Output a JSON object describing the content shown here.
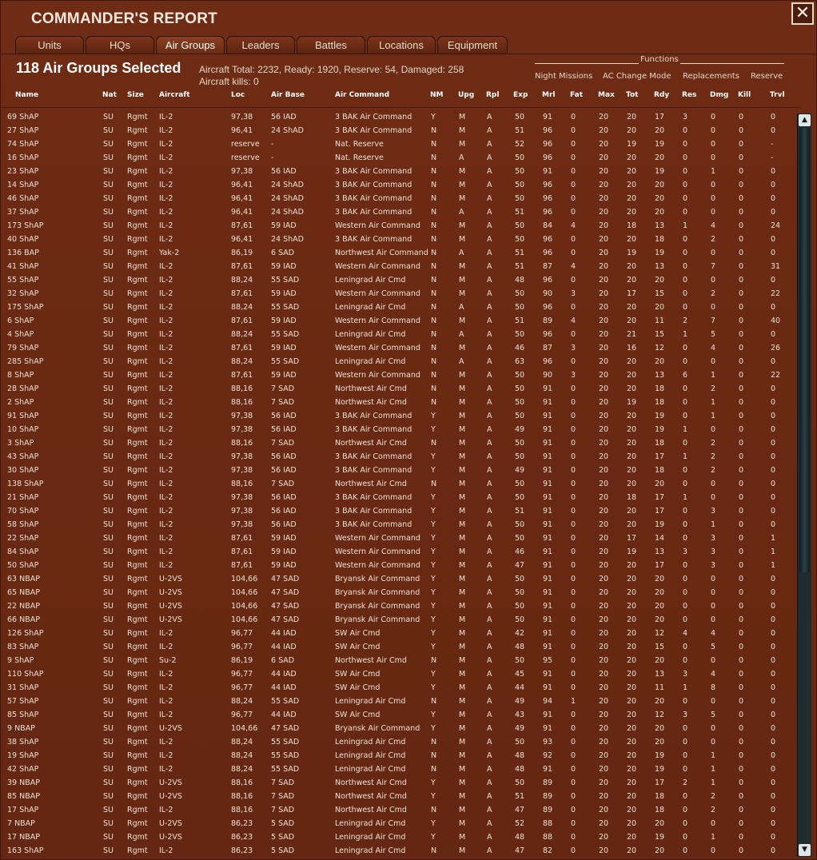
{
  "window": {
    "title": "COMMANDER'S REPORT",
    "close_label": "✕"
  },
  "tabs": [
    {
      "label": "Units",
      "active": false
    },
    {
      "label": "HQs",
      "active": false
    },
    {
      "label": "Air Groups",
      "active": true
    },
    {
      "label": "Leaders",
      "active": false
    },
    {
      "label": "Battles",
      "active": false
    },
    {
      "label": "Locations",
      "active": false
    },
    {
      "label": "Equipment",
      "active": false
    }
  ],
  "summary": {
    "selected": "118 Air Groups Selected",
    "aircraft_line": "Aircraft Total: 2232, Ready: 1920, Reserve: 54, Damaged: 258",
    "kills_line": "Aircraft kills: 0"
  },
  "functions": {
    "title": "Functions",
    "buttons": [
      "Night Missions",
      "AC Change Mode",
      "Replacements",
      "Reserve"
    ]
  },
  "table": {
    "columns": [
      "Name",
      "Nat",
      "Size",
      "Aircraft",
      "Loc",
      "Air Base",
      "Air Command",
      "NM",
      "Upg",
      "Rpl",
      "Exp",
      "Mrl",
      "Fat",
      "Max",
      "Tot",
      "Rdy",
      "Res",
      "Dmg",
      "Kill",
      "Trvl"
    ],
    "rows": [
      [
        "69 ShAP",
        "SU",
        "Rgmt",
        "IL-2",
        "97,38",
        "56 IAD",
        "3 BAK Air Command",
        "Y",
        "M",
        "A",
        "50",
        "91",
        "0",
        "20",
        "20",
        "17",
        "3",
        "0",
        "0",
        "0"
      ],
      [
        "27 ShAP",
        "SU",
        "Rgmt",
        "IL-2",
        "96,41",
        "24 ShAD",
        "3 BAK Air Command",
        "N",
        "M",
        "A",
        "51",
        "96",
        "0",
        "20",
        "20",
        "20",
        "0",
        "0",
        "0",
        "0"
      ],
      [
        "74 ShAP",
        "SU",
        "Rgmt",
        "IL-2",
        "reserve",
        "-",
        "Nat. Reserve",
        "N",
        "M",
        "A",
        "52",
        "96",
        "0",
        "20",
        "19",
        "19",
        "0",
        "0",
        "0",
        "-"
      ],
      [
        "16 ShAP",
        "SU",
        "Rgmt",
        "IL-2",
        "reserve",
        "-",
        "Nat. Reserve",
        "N",
        "A",
        "A",
        "50",
        "96",
        "0",
        "20",
        "20",
        "20",
        "0",
        "0",
        "0",
        "-"
      ],
      [
        "23 ShAP",
        "SU",
        "Rgmt",
        "IL-2",
        "97,38",
        "56 IAD",
        "3 BAK Air Command",
        "N",
        "M",
        "A",
        "50",
        "91",
        "0",
        "20",
        "20",
        "19",
        "0",
        "1",
        "0",
        "0"
      ],
      [
        "14 ShAP",
        "SU",
        "Rgmt",
        "IL-2",
        "96,41",
        "24 ShAD",
        "3 BAK Air Command",
        "N",
        "M",
        "A",
        "50",
        "96",
        "0",
        "20",
        "20",
        "20",
        "0",
        "0",
        "0",
        "0"
      ],
      [
        "46 ShAP",
        "SU",
        "Rgmt",
        "IL-2",
        "96,41",
        "24 ShAD",
        "3 BAK Air Command",
        "N",
        "M",
        "A",
        "50",
        "96",
        "0",
        "20",
        "20",
        "20",
        "0",
        "0",
        "0",
        "0"
      ],
      [
        "37 ShAP",
        "SU",
        "Rgmt",
        "IL-2",
        "96,41",
        "24 ShAD",
        "3 BAK Air Command",
        "N",
        "A",
        "A",
        "51",
        "96",
        "0",
        "20",
        "20",
        "20",
        "0",
        "0",
        "0",
        "0"
      ],
      [
        "173 ShAP",
        "SU",
        "Rgmt",
        "IL-2",
        "87,61",
        "59 IAD",
        "Western Air Command",
        "N",
        "M",
        "A",
        "50",
        "84",
        "4",
        "20",
        "18",
        "13",
        "1",
        "4",
        "0",
        "24"
      ],
      [
        "40 ShAP",
        "SU",
        "Rgmt",
        "IL-2",
        "96,41",
        "24 ShAD",
        "3 BAK Air Command",
        "N",
        "M",
        "A",
        "50",
        "96",
        "0",
        "20",
        "20",
        "18",
        "0",
        "2",
        "0",
        "0"
      ],
      [
        "136 BAP",
        "SU",
        "Rgmt",
        "Yak-2",
        "86,19",
        "6 SAD",
        "Northwest Air Command",
        "N",
        "A",
        "A",
        "51",
        "96",
        "0",
        "20",
        "19",
        "19",
        "0",
        "0",
        "0",
        "0"
      ],
      [
        "41 ShAP",
        "SU",
        "Rgmt",
        "IL-2",
        "87,61",
        "59 IAD",
        "Western Air Command",
        "N",
        "M",
        "A",
        "51",
        "87",
        "4",
        "20",
        "20",
        "13",
        "0",
        "7",
        "0",
        "31"
      ],
      [
        "55 ShAP",
        "SU",
        "Rgmt",
        "IL-2",
        "88,24",
        "55 SAD",
        "Leningrad Air Cmd",
        "N",
        "M",
        "A",
        "48",
        "96",
        "0",
        "20",
        "20",
        "20",
        "0",
        "0",
        "0",
        "0"
      ],
      [
        "32 ShAP",
        "SU",
        "Rgmt",
        "IL-2",
        "87,61",
        "59 IAD",
        "Western Air Command",
        "N",
        "M",
        "A",
        "50",
        "90",
        "3",
        "20",
        "17",
        "15",
        "0",
        "2",
        "0",
        "22"
      ],
      [
        "175 ShAP",
        "SU",
        "Rgmt",
        "IL-2",
        "88,24",
        "55 SAD",
        "Leningrad Air Cmd",
        "N",
        "A",
        "A",
        "50",
        "96",
        "0",
        "20",
        "20",
        "20",
        "0",
        "0",
        "0",
        "0"
      ],
      [
        "6 ShAP",
        "SU",
        "Rgmt",
        "IL-2",
        "87,61",
        "59 IAD",
        "Western Air Command",
        "N",
        "M",
        "A",
        "51",
        "89",
        "4",
        "20",
        "20",
        "11",
        "2",
        "7",
        "0",
        "40"
      ],
      [
        "4 ShAP",
        "SU",
        "Rgmt",
        "IL-2",
        "88,24",
        "55 SAD",
        "Leningrad Air Cmd",
        "N",
        "A",
        "A",
        "50",
        "96",
        "0",
        "20",
        "21",
        "15",
        "1",
        "5",
        "0",
        "0"
      ],
      [
        "79 ShAP",
        "SU",
        "Rgmt",
        "IL-2",
        "87,61",
        "59 IAD",
        "Western Air Command",
        "N",
        "M",
        "A",
        "46",
        "87",
        "3",
        "20",
        "16",
        "12",
        "0",
        "4",
        "0",
        "26"
      ],
      [
        "285 ShAP",
        "SU",
        "Rgmt",
        "IL-2",
        "88,24",
        "55 SAD",
        "Leningrad Air Cmd",
        "N",
        "A",
        "A",
        "63",
        "96",
        "0",
        "20",
        "20",
        "20",
        "0",
        "0",
        "0",
        "0"
      ],
      [
        "8 ShAP",
        "SU",
        "Rgmt",
        "IL-2",
        "87,61",
        "59 IAD",
        "Western Air Command",
        "N",
        "M",
        "A",
        "50",
        "90",
        "3",
        "20",
        "20",
        "13",
        "6",
        "1",
        "0",
        "22"
      ],
      [
        "28 ShAP",
        "SU",
        "Rgmt",
        "IL-2",
        "88,16",
        "7 SAD",
        "Northwest Air Cmd",
        "N",
        "M",
        "A",
        "50",
        "91",
        "0",
        "20",
        "20",
        "18",
        "0",
        "2",
        "0",
        "0"
      ],
      [
        "2 ShAP",
        "SU",
        "Rgmt",
        "IL-2",
        "88,16",
        "7 SAD",
        "Northwest Air Cmd",
        "N",
        "M",
        "A",
        "50",
        "91",
        "0",
        "20",
        "19",
        "18",
        "0",
        "1",
        "0",
        "0"
      ],
      [
        "91 ShAP",
        "SU",
        "Rgmt",
        "IL-2",
        "97,38",
        "56 IAD",
        "3 BAK Air Command",
        "Y",
        "M",
        "A",
        "50",
        "91",
        "0",
        "20",
        "20",
        "19",
        "0",
        "1",
        "0",
        "0"
      ],
      [
        "10 ShAP",
        "SU",
        "Rgmt",
        "IL-2",
        "97,38",
        "56 IAD",
        "3 BAK Air Command",
        "Y",
        "M",
        "A",
        "49",
        "91",
        "0",
        "20",
        "20",
        "19",
        "1",
        "0",
        "0",
        "0"
      ],
      [
        "3 ShAP",
        "SU",
        "Rgmt",
        "IL-2",
        "88,16",
        "7 SAD",
        "Northwest Air Cmd",
        "N",
        "M",
        "A",
        "50",
        "91",
        "0",
        "20",
        "20",
        "18",
        "0",
        "2",
        "0",
        "0"
      ],
      [
        "43 ShAP",
        "SU",
        "Rgmt",
        "IL-2",
        "97,38",
        "56 IAD",
        "3 BAK Air Command",
        "Y",
        "M",
        "A",
        "50",
        "91",
        "0",
        "20",
        "20",
        "17",
        "1",
        "2",
        "0",
        "0"
      ],
      [
        "30 ShAP",
        "SU",
        "Rgmt",
        "IL-2",
        "97,38",
        "56 IAD",
        "3 BAK Air Command",
        "Y",
        "M",
        "A",
        "49",
        "91",
        "0",
        "20",
        "20",
        "18",
        "0",
        "2",
        "0",
        "0"
      ],
      [
        "138 ShAP",
        "SU",
        "Rgmt",
        "IL-2",
        "88,16",
        "7 SAD",
        "Northwest Air Cmd",
        "N",
        "M",
        "A",
        "50",
        "91",
        "0",
        "20",
        "20",
        "20",
        "0",
        "0",
        "0",
        "0"
      ],
      [
        "21 ShAP",
        "SU",
        "Rgmt",
        "IL-2",
        "97,38",
        "56 IAD",
        "3 BAK Air Command",
        "Y",
        "M",
        "A",
        "50",
        "91",
        "0",
        "20",
        "18",
        "17",
        "1",
        "0",
        "0",
        "0"
      ],
      [
        "70 ShAP",
        "SU",
        "Rgmt",
        "IL-2",
        "97,38",
        "56 IAD",
        "3 BAK Air Command",
        "Y",
        "M",
        "A",
        "51",
        "91",
        "0",
        "20",
        "20",
        "17",
        "0",
        "3",
        "0",
        "0"
      ],
      [
        "58 ShAP",
        "SU",
        "Rgmt",
        "IL-2",
        "97,38",
        "56 IAD",
        "3 BAK Air Command",
        "Y",
        "M",
        "A",
        "50",
        "91",
        "0",
        "20",
        "20",
        "19",
        "0",
        "1",
        "0",
        "0"
      ],
      [
        "22 ShAP",
        "SU",
        "Rgmt",
        "IL-2",
        "87,61",
        "59 IAD",
        "Western Air Command",
        "Y",
        "M",
        "A",
        "50",
        "91",
        "0",
        "20",
        "17",
        "14",
        "0",
        "3",
        "0",
        "1"
      ],
      [
        "84 ShAP",
        "SU",
        "Rgmt",
        "IL-2",
        "87,61",
        "59 IAD",
        "Western Air Command",
        "Y",
        "M",
        "A",
        "46",
        "91",
        "0",
        "20",
        "19",
        "13",
        "3",
        "3",
        "0",
        "1"
      ],
      [
        "50 ShAP",
        "SU",
        "Rgmt",
        "IL-2",
        "87,61",
        "59 IAD",
        "Western Air Command",
        "Y",
        "M",
        "A",
        "47",
        "91",
        "0",
        "20",
        "20",
        "17",
        "0",
        "3",
        "0",
        "1"
      ],
      [
        "63 NBAP",
        "SU",
        "Rgmt",
        "U-2VS",
        "104,66",
        "47 SAD",
        "Bryansk Air Command",
        "Y",
        "M",
        "A",
        "50",
        "91",
        "0",
        "20",
        "20",
        "20",
        "0",
        "0",
        "0",
        "0"
      ],
      [
        "65 NBAP",
        "SU",
        "Rgmt",
        "U-2VS",
        "104,66",
        "47 SAD",
        "Bryansk Air Command",
        "Y",
        "M",
        "A",
        "50",
        "91",
        "0",
        "20",
        "20",
        "20",
        "0",
        "0",
        "0",
        "0"
      ],
      [
        "22 NBAP",
        "SU",
        "Rgmt",
        "U-2VS",
        "104,66",
        "47 SAD",
        "Bryansk Air Command",
        "Y",
        "M",
        "A",
        "50",
        "91",
        "0",
        "20",
        "20",
        "20",
        "0",
        "0",
        "0",
        "0"
      ],
      [
        "66 NBAP",
        "SU",
        "Rgmt",
        "U-2VS",
        "104,66",
        "47 SAD",
        "Bryansk Air Command",
        "Y",
        "M",
        "A",
        "50",
        "91",
        "0",
        "20",
        "20",
        "20",
        "0",
        "0",
        "0",
        "0"
      ],
      [
        "126 ShAP",
        "SU",
        "Rgmt",
        "IL-2",
        "96,77",
        "44 IAD",
        "SW Air Cmd",
        "Y",
        "M",
        "A",
        "42",
        "91",
        "0",
        "20",
        "20",
        "12",
        "4",
        "4",
        "0",
        "0"
      ],
      [
        "83 ShAP",
        "SU",
        "Rgmt",
        "IL-2",
        "96,77",
        "44 IAD",
        "SW Air Cmd",
        "Y",
        "M",
        "A",
        "48",
        "91",
        "0",
        "20",
        "20",
        "15",
        "0",
        "5",
        "0",
        "0"
      ],
      [
        "9 ShAP",
        "SU",
        "Rgmt",
        "Su-2",
        "86,19",
        "6 SAD",
        "Northwest Air Cmd",
        "N",
        "M",
        "A",
        "50",
        "95",
        "0",
        "20",
        "20",
        "20",
        "0",
        "0",
        "0",
        "0"
      ],
      [
        "110 ShAP",
        "SU",
        "Rgmt",
        "IL-2",
        "96,77",
        "44 IAD",
        "SW Air Cmd",
        "Y",
        "M",
        "A",
        "45",
        "91",
        "0",
        "20",
        "20",
        "13",
        "3",
        "4",
        "0",
        "0"
      ],
      [
        "31 ShAP",
        "SU",
        "Rgmt",
        "IL-2",
        "96,77",
        "44 IAD",
        "SW Air Cmd",
        "Y",
        "M",
        "A",
        "44",
        "91",
        "0",
        "20",
        "20",
        "11",
        "1",
        "8",
        "0",
        "0"
      ],
      [
        "57 ShAP",
        "SU",
        "Rgmt",
        "IL-2",
        "88,24",
        "55 SAD",
        "Leningrad Air Cmd",
        "N",
        "M",
        "A",
        "49",
        "94",
        "1",
        "20",
        "20",
        "20",
        "0",
        "0",
        "0",
        "0"
      ],
      [
        "85 ShAP",
        "SU",
        "Rgmt",
        "IL-2",
        "96,77",
        "44 IAD",
        "SW Air Cmd",
        "Y",
        "M",
        "A",
        "43",
        "91",
        "0",
        "20",
        "20",
        "12",
        "3",
        "5",
        "0",
        "0"
      ],
      [
        "9 NBAP",
        "SU",
        "Rgmt",
        "U-2VS",
        "104,66",
        "47 SAD",
        "Bryansk Air Command",
        "Y",
        "M",
        "A",
        "49",
        "91",
        "0",
        "20",
        "20",
        "20",
        "0",
        "0",
        "0",
        "0"
      ],
      [
        "38 ShAP",
        "SU",
        "Rgmt",
        "IL-2",
        "88,24",
        "55 SAD",
        "Leningrad Air Cmd",
        "N",
        "M",
        "A",
        "50",
        "93",
        "0",
        "20",
        "20",
        "20",
        "0",
        "0",
        "0",
        "0"
      ],
      [
        "19 ShAP",
        "SU",
        "Rgmt",
        "IL-2",
        "88,24",
        "55 SAD",
        "Leningrad Air Cmd",
        "N",
        "M",
        "A",
        "48",
        "92",
        "0",
        "20",
        "20",
        "19",
        "0",
        "1",
        "0",
        "0"
      ],
      [
        "42 ShAP",
        "SU",
        "Rgmt",
        "IL-2",
        "88,24",
        "55 SAD",
        "Leningrad Air Cmd",
        "N",
        "M",
        "A",
        "48",
        "91",
        "0",
        "20",
        "20",
        "19",
        "0",
        "1",
        "0",
        "0"
      ],
      [
        "39 NBAP",
        "SU",
        "Rgmt",
        "U-2VS",
        "88,16",
        "7 SAD",
        "Northwest Air Cmd",
        "Y",
        "M",
        "A",
        "50",
        "89",
        "0",
        "20",
        "20",
        "17",
        "2",
        "1",
        "0",
        "0"
      ],
      [
        "85 NBAP",
        "SU",
        "Rgmt",
        "U-2VS",
        "88,16",
        "7 SAD",
        "Northwest Air Cmd",
        "Y",
        "M",
        "A",
        "51",
        "89",
        "0",
        "20",
        "20",
        "18",
        "0",
        "2",
        "0",
        "0"
      ],
      [
        "17 ShAP",
        "SU",
        "Rgmt",
        "IL-2",
        "88,16",
        "7 SAD",
        "Northwest Air Cmd",
        "N",
        "M",
        "A",
        "47",
        "89",
        "0",
        "20",
        "20",
        "18",
        "0",
        "2",
        "0",
        "0"
      ],
      [
        "7 NBAP",
        "SU",
        "Rgmt",
        "U-2VS",
        "86,23",
        "5 SAD",
        "Leningrad Air Cmd",
        "Y",
        "M",
        "A",
        "52",
        "88",
        "0",
        "20",
        "20",
        "20",
        "0",
        "0",
        "0",
        "0"
      ],
      [
        "17 NBAP",
        "SU",
        "Rgmt",
        "U-2VS",
        "86,23",
        "5 SAD",
        "Leningrad Air Cmd",
        "Y",
        "M",
        "A",
        "48",
        "88",
        "0",
        "20",
        "20",
        "19",
        "0",
        "1",
        "0",
        "0"
      ],
      [
        "163 ShAP",
        "SU",
        "Rgmt",
        "IL-2",
        "86,23",
        "5 SAD",
        "Leningrad Air Cmd",
        "N",
        "M",
        "A",
        "47",
        "82",
        "0",
        "20",
        "20",
        "20",
        "0",
        "0",
        "0",
        "0"
      ]
    ]
  },
  "scrollbar": {
    "up_icon": "▲",
    "down_icon": "▼"
  }
}
